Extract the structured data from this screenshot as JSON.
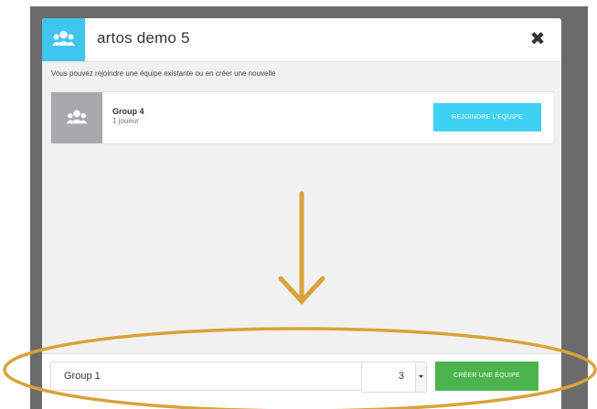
{
  "modal": {
    "title": "artos demo 5",
    "close_symbol": "✖",
    "header_icon": "users-icon",
    "instructions": "Vous pouvez rejoindre une équipe existante ou en créer une nouvelle"
  },
  "teams": [
    {
      "name": "Group 4",
      "members": "1 joueur",
      "join_label": "Rejoindre l'équipe",
      "avatar_icon": "users-icon"
    }
  ],
  "create_form": {
    "name_value": "Group 1",
    "size_value": "3",
    "create_label": "Créer une équipe"
  },
  "annotation": {
    "arrow_icon": "arrow-down-icon",
    "color": "#d9a23a"
  },
  "colors": {
    "accent_blue": "#3ec6ee",
    "join_blue": "#3fd1f3",
    "create_green": "#4cb44c"
  }
}
